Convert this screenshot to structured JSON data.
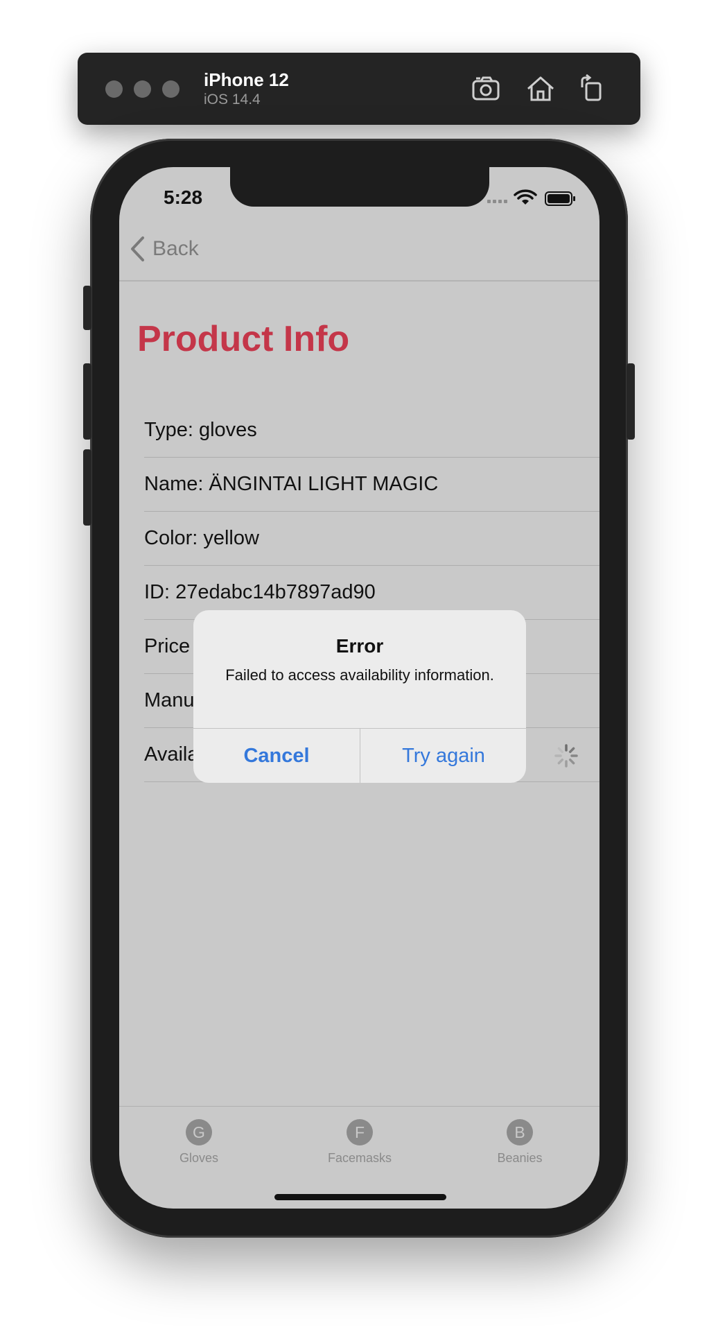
{
  "simulator": {
    "device_name": "iPhone 12",
    "os_version": "iOS 14.4",
    "buttons": [
      "camera-icon",
      "home-icon",
      "rotate-icon"
    ]
  },
  "status_bar": {
    "time": "5:28"
  },
  "nav": {
    "back_label": "Back"
  },
  "page": {
    "title": "Product Info",
    "accent_color": "#c43649"
  },
  "rows": [
    {
      "label": "Type:",
      "value": "gloves"
    },
    {
      "label": "Name:",
      "value": "ÄNGINTAI LIGHT MAGIC"
    },
    {
      "label": "Color:",
      "value": "yellow"
    },
    {
      "label": "ID:",
      "value": "27edabc14b7897ad90"
    },
    {
      "label": "Price",
      "value": ""
    },
    {
      "label": "Manu",
      "value": ""
    },
    {
      "label": "Availa",
      "value": ""
    }
  ],
  "alert": {
    "title": "Error",
    "message": "Failed to access availability information.",
    "cancel_label": "Cancel",
    "retry_label": "Try again",
    "button_color": "#3478db"
  },
  "tabs": [
    {
      "icon_letter": "G",
      "label": "Gloves"
    },
    {
      "icon_letter": "F",
      "label": "Facemasks"
    },
    {
      "icon_letter": "B",
      "label": "Beanies"
    }
  ]
}
